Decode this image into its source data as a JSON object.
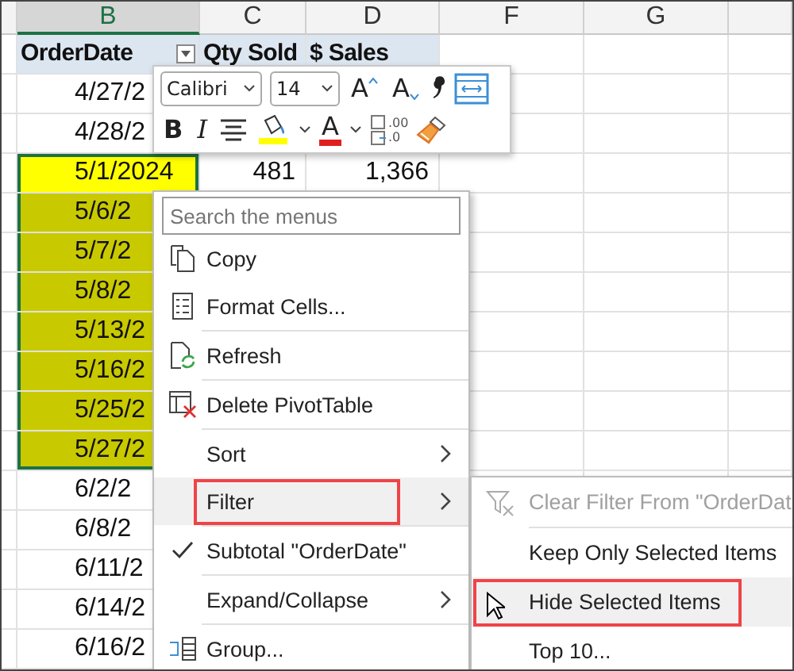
{
  "columns": [
    {
      "label": "B",
      "selected": true
    },
    {
      "label": "C",
      "selected": false
    },
    {
      "label": "D",
      "selected": false
    },
    {
      "label": "F",
      "selected": false
    },
    {
      "label": "G",
      "selected": false
    }
  ],
  "pivot_header": {
    "row_field": "OrderDate",
    "values": [
      "Qty Sold",
      "$ Sales"
    ]
  },
  "rows": [
    {
      "date": "4/27/2",
      "selected": false
    },
    {
      "date": "4/28/2",
      "selected": false
    },
    {
      "date": "5/1/2024",
      "qty": "481",
      "sales": "1,366",
      "selected": true,
      "color": "#ffff00"
    },
    {
      "date": "5/6/2",
      "selected": true,
      "color": "#c9c900"
    },
    {
      "date": "5/7/2",
      "selected": true,
      "color": "#c9c900"
    },
    {
      "date": "5/8/2",
      "selected": true,
      "color": "#c9c900"
    },
    {
      "date": "5/13/2",
      "selected": true,
      "color": "#c9c900"
    },
    {
      "date": "5/16/2",
      "selected": true,
      "color": "#c9c900"
    },
    {
      "date": "5/25/2",
      "selected": true,
      "color": "#c9c900"
    },
    {
      "date": "5/27/2",
      "selected": true,
      "color": "#c9c900"
    },
    {
      "date": "6/2/2",
      "selected": false
    },
    {
      "date": "6/8/2",
      "selected": false
    },
    {
      "date": "6/11/2",
      "selected": false
    },
    {
      "date": "6/14/2",
      "selected": false
    },
    {
      "date": "6/16/2",
      "selected": false
    }
  ],
  "mini_toolbar": {
    "font": "Calibri",
    "size": "14",
    "grow_font": "A",
    "shrink_font": "A",
    "bold": "B",
    "italic": "I",
    "font_color": "A",
    "decimals_top": ".00",
    "decimals_bottom": ".0"
  },
  "context_menu": {
    "search": {
      "placeholder": "Search the menus"
    },
    "items": [
      {
        "label": "Copy",
        "separator_before": false,
        "checked": false,
        "has_submenu": false,
        "highlighted": false,
        "callout": false
      },
      {
        "label": "Format Cells...",
        "separator_before": false,
        "checked": false,
        "has_submenu": false,
        "highlighted": false,
        "callout": false
      },
      {
        "label": "Refresh",
        "separator_before": true,
        "checked": false,
        "has_submenu": false,
        "highlighted": false,
        "callout": false
      },
      {
        "label": "Delete PivotTable",
        "separator_before": true,
        "checked": false,
        "has_submenu": false,
        "highlighted": false,
        "callout": false
      },
      {
        "label": "Sort",
        "separator_before": true,
        "checked": false,
        "has_submenu": true,
        "highlighted": false,
        "callout": false
      },
      {
        "label": "Filter",
        "separator_before": false,
        "checked": false,
        "has_submenu": true,
        "highlighted": true,
        "callout": true
      },
      {
        "label": "Subtotal \"OrderDate\"",
        "separator_before": true,
        "checked": true,
        "has_submenu": false,
        "highlighted": false,
        "callout": false
      },
      {
        "label": "Expand/Collapse",
        "separator_before": true,
        "checked": false,
        "has_submenu": true,
        "highlighted": false,
        "callout": false
      },
      {
        "label": "Group...",
        "separator_before": true,
        "checked": false,
        "has_submenu": false,
        "highlighted": false,
        "callout": false
      }
    ]
  },
  "filter_submenu": {
    "items": [
      {
        "label": "Clear Filter From \"OrderDat",
        "disabled": true,
        "highlighted": false,
        "callout": false
      },
      {
        "label": "Keep Only Selected Items",
        "disabled": false,
        "highlighted": false,
        "callout": false
      },
      {
        "label": "Hide Selected Items",
        "disabled": false,
        "highlighted": true,
        "callout": true
      },
      {
        "label": "Top 10...",
        "disabled": false,
        "highlighted": false,
        "callout": false
      }
    ]
  }
}
